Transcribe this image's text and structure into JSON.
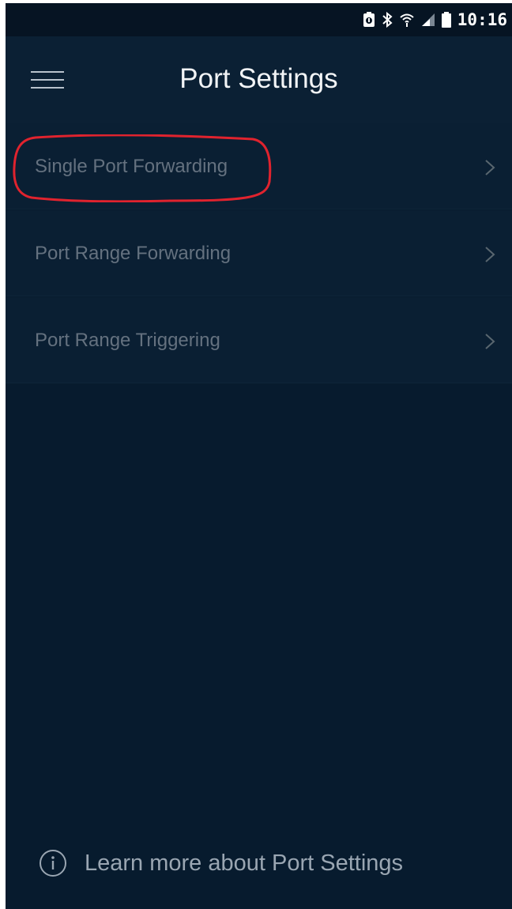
{
  "status_bar": {
    "time": "10:16",
    "icons": [
      "battery-saver-icon",
      "bluetooth-icon",
      "wifi-icon",
      "signal-icon",
      "battery-icon"
    ]
  },
  "header": {
    "title": "Port Settings",
    "menu_icon": "hamburger-menu-icon"
  },
  "settings": {
    "items": [
      {
        "label": "Single Port Forwarding",
        "icon": "chevron-right-icon",
        "highlighted": true
      },
      {
        "label": "Port Range Forwarding",
        "icon": "chevron-right-icon"
      },
      {
        "label": "Port Range Triggering",
        "icon": "chevron-right-icon"
      }
    ]
  },
  "footer": {
    "link_text": "Learn more about Port Settings",
    "icon": "info-icon"
  },
  "colors": {
    "background": "#071b2e",
    "header": "#0b2034",
    "list_item": "#0a1f33",
    "item_text": "#64717f",
    "highlight": "#e0232e"
  }
}
